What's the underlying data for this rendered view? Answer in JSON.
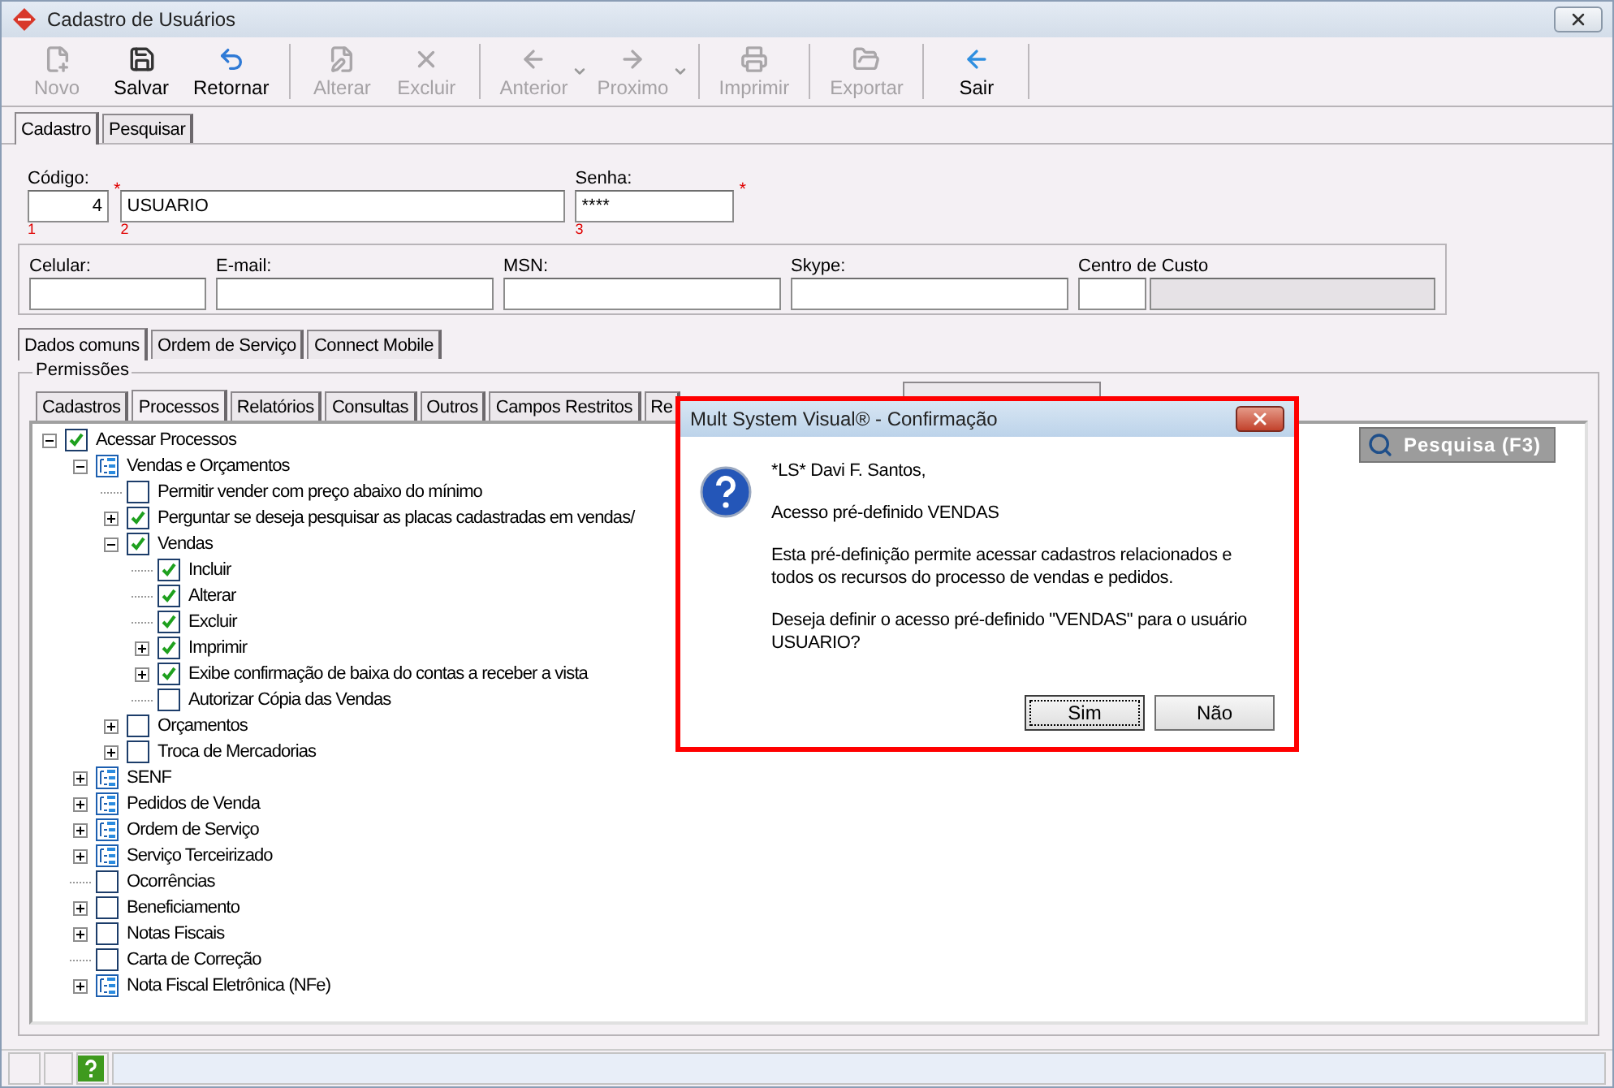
{
  "window": {
    "title": "Cadastro de Usuários"
  },
  "toolbar": [
    {
      "label": "Novo",
      "kind": "new",
      "enabled": false
    },
    {
      "label": "Salvar",
      "kind": "save",
      "enabled": true
    },
    {
      "label": "Retornar",
      "kind": "undo",
      "enabled": true
    },
    {
      "label": "Alterar",
      "kind": "edit",
      "enabled": false
    },
    {
      "label": "Excluir",
      "kind": "delete",
      "enabled": false
    },
    {
      "label": "Anterior",
      "kind": "previous",
      "enabled": false,
      "has_menu": true
    },
    {
      "label": "Proximo",
      "kind": "next",
      "enabled": false,
      "has_menu": true
    },
    {
      "label": "Imprimir",
      "kind": "print",
      "enabled": false
    },
    {
      "label": "Exportar",
      "kind": "export",
      "enabled": false
    },
    {
      "label": "Sair",
      "kind": "exit",
      "enabled": true
    }
  ],
  "tabs": [
    {
      "label": "Cadastro",
      "selected": true
    },
    {
      "label": "Pesquisar",
      "selected": false
    }
  ],
  "identity": {
    "code": {
      "label": "Código:",
      "value": "4",
      "mark": "*",
      "order": "1"
    },
    "name": {
      "value": "USUARIO",
      "order": "2"
    },
    "password": {
      "label": "Senha:",
      "value": "****",
      "mark": "*",
      "order": "3"
    }
  },
  "contact_fields": [
    {
      "label": "Celular:",
      "kind": "text"
    },
    {
      "label": "E-mail:",
      "kind": "text"
    },
    {
      "label": "MSN:",
      "kind": "text"
    },
    {
      "label": "Skype:",
      "kind": "text"
    },
    {
      "label": "Centro de Custo",
      "kind": "lookup"
    }
  ],
  "detail_tabs": [
    {
      "label": "Dados comuns",
      "selected": true
    },
    {
      "label": "Ordem de Serviço",
      "selected": false
    },
    {
      "label": "Connect Mobile",
      "selected": false
    }
  ],
  "permissions": {
    "title": "Permissões",
    "tabs": [
      {
        "label": "Cadastros",
        "selected": false
      },
      {
        "label": "Processos",
        "selected": true
      },
      {
        "label": "Relatórios",
        "selected": false
      },
      {
        "label": "Consultas",
        "selected": false
      },
      {
        "label": "Outros",
        "selected": false
      },
      {
        "label": "Campos Restritos",
        "selected": false
      },
      {
        "label": "Re",
        "selected": false
      }
    ],
    "search_button": "Pesquisa (F3)",
    "tree": [
      {
        "label": "Acessar Processos",
        "kind": "check",
        "checked": true,
        "expanded": true,
        "children": [
          {
            "label": "Vendas e Orçamentos",
            "kind": "group",
            "expanded": true,
            "children": [
              {
                "label": "Permitir vender com preço abaixo do mínimo",
                "kind": "check",
                "checked": false
              },
              {
                "label": "Perguntar se deseja pesquisar as placas cadastradas em vendas/",
                "kind": "check",
                "checked": true,
                "expanded": false
              },
              {
                "label": "Vendas",
                "kind": "check",
                "checked": true,
                "expanded": true,
                "children": [
                  {
                    "label": "Incluir",
                    "kind": "check",
                    "checked": true
                  },
                  {
                    "label": "Alterar",
                    "kind": "check",
                    "checked": true
                  },
                  {
                    "label": "Excluir",
                    "kind": "check",
                    "checked": true
                  },
                  {
                    "label": "Imprimir",
                    "kind": "check",
                    "checked": true,
                    "expanded": false
                  },
                  {
                    "label": "Exibe confirmação de baixa do contas a receber a vista",
                    "kind": "check",
                    "checked": true,
                    "expanded": false
                  },
                  {
                    "label": "Autorizar Cópia das Vendas",
                    "kind": "check",
                    "checked": false
                  }
                ]
              },
              {
                "label": "Orçamentos",
                "kind": "check",
                "checked": false,
                "expanded": false
              },
              {
                "label": "Troca de Mercadorias",
                "kind": "check",
                "checked": false,
                "expanded": false
              }
            ]
          },
          {
            "label": "SENF",
            "kind": "group",
            "expanded": false
          },
          {
            "label": "Pedidos de Venda",
            "kind": "group",
            "expanded": false
          },
          {
            "label": "Ordem de Serviço",
            "kind": "group",
            "expanded": false
          },
          {
            "label": "Serviço Terceirizado",
            "kind": "group",
            "expanded": false
          },
          {
            "label": "Ocorrências",
            "kind": "check",
            "checked": false
          },
          {
            "label": "Beneficiamento",
            "kind": "check",
            "checked": false,
            "expanded": false
          },
          {
            "label": "Notas Fiscais",
            "kind": "check",
            "checked": false,
            "expanded": false
          },
          {
            "label": "Carta de Correção",
            "kind": "check",
            "checked": false
          },
          {
            "label": "Nota Fiscal Eletrônica (NFe)",
            "kind": "group",
            "expanded": false
          }
        ]
      }
    ]
  },
  "dialog": {
    "title": "Mult System Visual® - Confirmação",
    "paragraphs": [
      "*LS* Davi F. Santos,",
      "Acesso pré-definido VENDAS",
      "Esta pré-definição permite acessar cadastros relacionados e todos os recursos do processo de vendas e pedidos.",
      "Deseja definir o acesso pré-definido \"VENDAS\" para o usuário USUARIO?"
    ],
    "buttons": [
      {
        "label": "Sim",
        "focused": true
      },
      {
        "label": "Não",
        "focused": false
      }
    ]
  }
}
